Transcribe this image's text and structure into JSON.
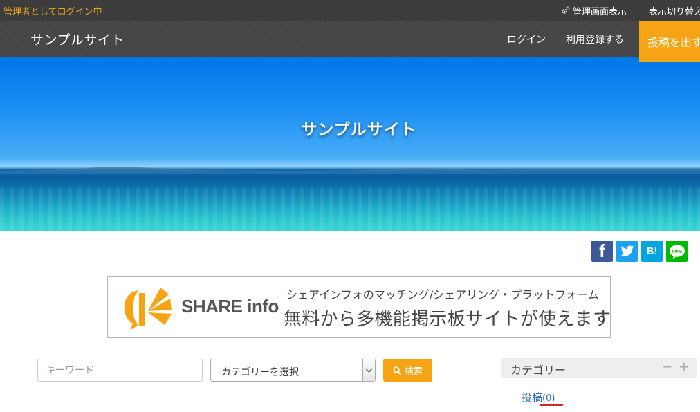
{
  "adminbar": {
    "status": "管理者としてログイン中",
    "admin_view": "管理画面表示",
    "admin_view_icon": "gears-icon",
    "display_switch": "表示切り替え"
  },
  "header": {
    "site_title": "サンプルサイト",
    "nav": {
      "login": "ログイン",
      "register": "利用登録する"
    },
    "post_button": "投稿を出す"
  },
  "hero": {
    "title": "サンプルサイト"
  },
  "share": {
    "facebook": "f",
    "hatena": "B!",
    "line": "LINE"
  },
  "banner": {
    "brand": "SHARE info",
    "tagline": "シェアインフォのマッチング/シェアリング・プラットフォーム",
    "headline": "無料から多機能掲示板サイトが使えます"
  },
  "search": {
    "keyword_placeholder": "キーワード",
    "category_selected": "カテゴリーを選択",
    "button": "検索"
  },
  "sidebar": {
    "widget_title": "カテゴリー",
    "minus": "−",
    "plus": "+",
    "items": [
      {
        "label": "投稿",
        "count": "(0)"
      }
    ]
  },
  "colors": {
    "accent": "#f7a414",
    "admin_status": "#f3a81a",
    "link": "#2f6fb0",
    "annotation_red": "#d9262c"
  }
}
